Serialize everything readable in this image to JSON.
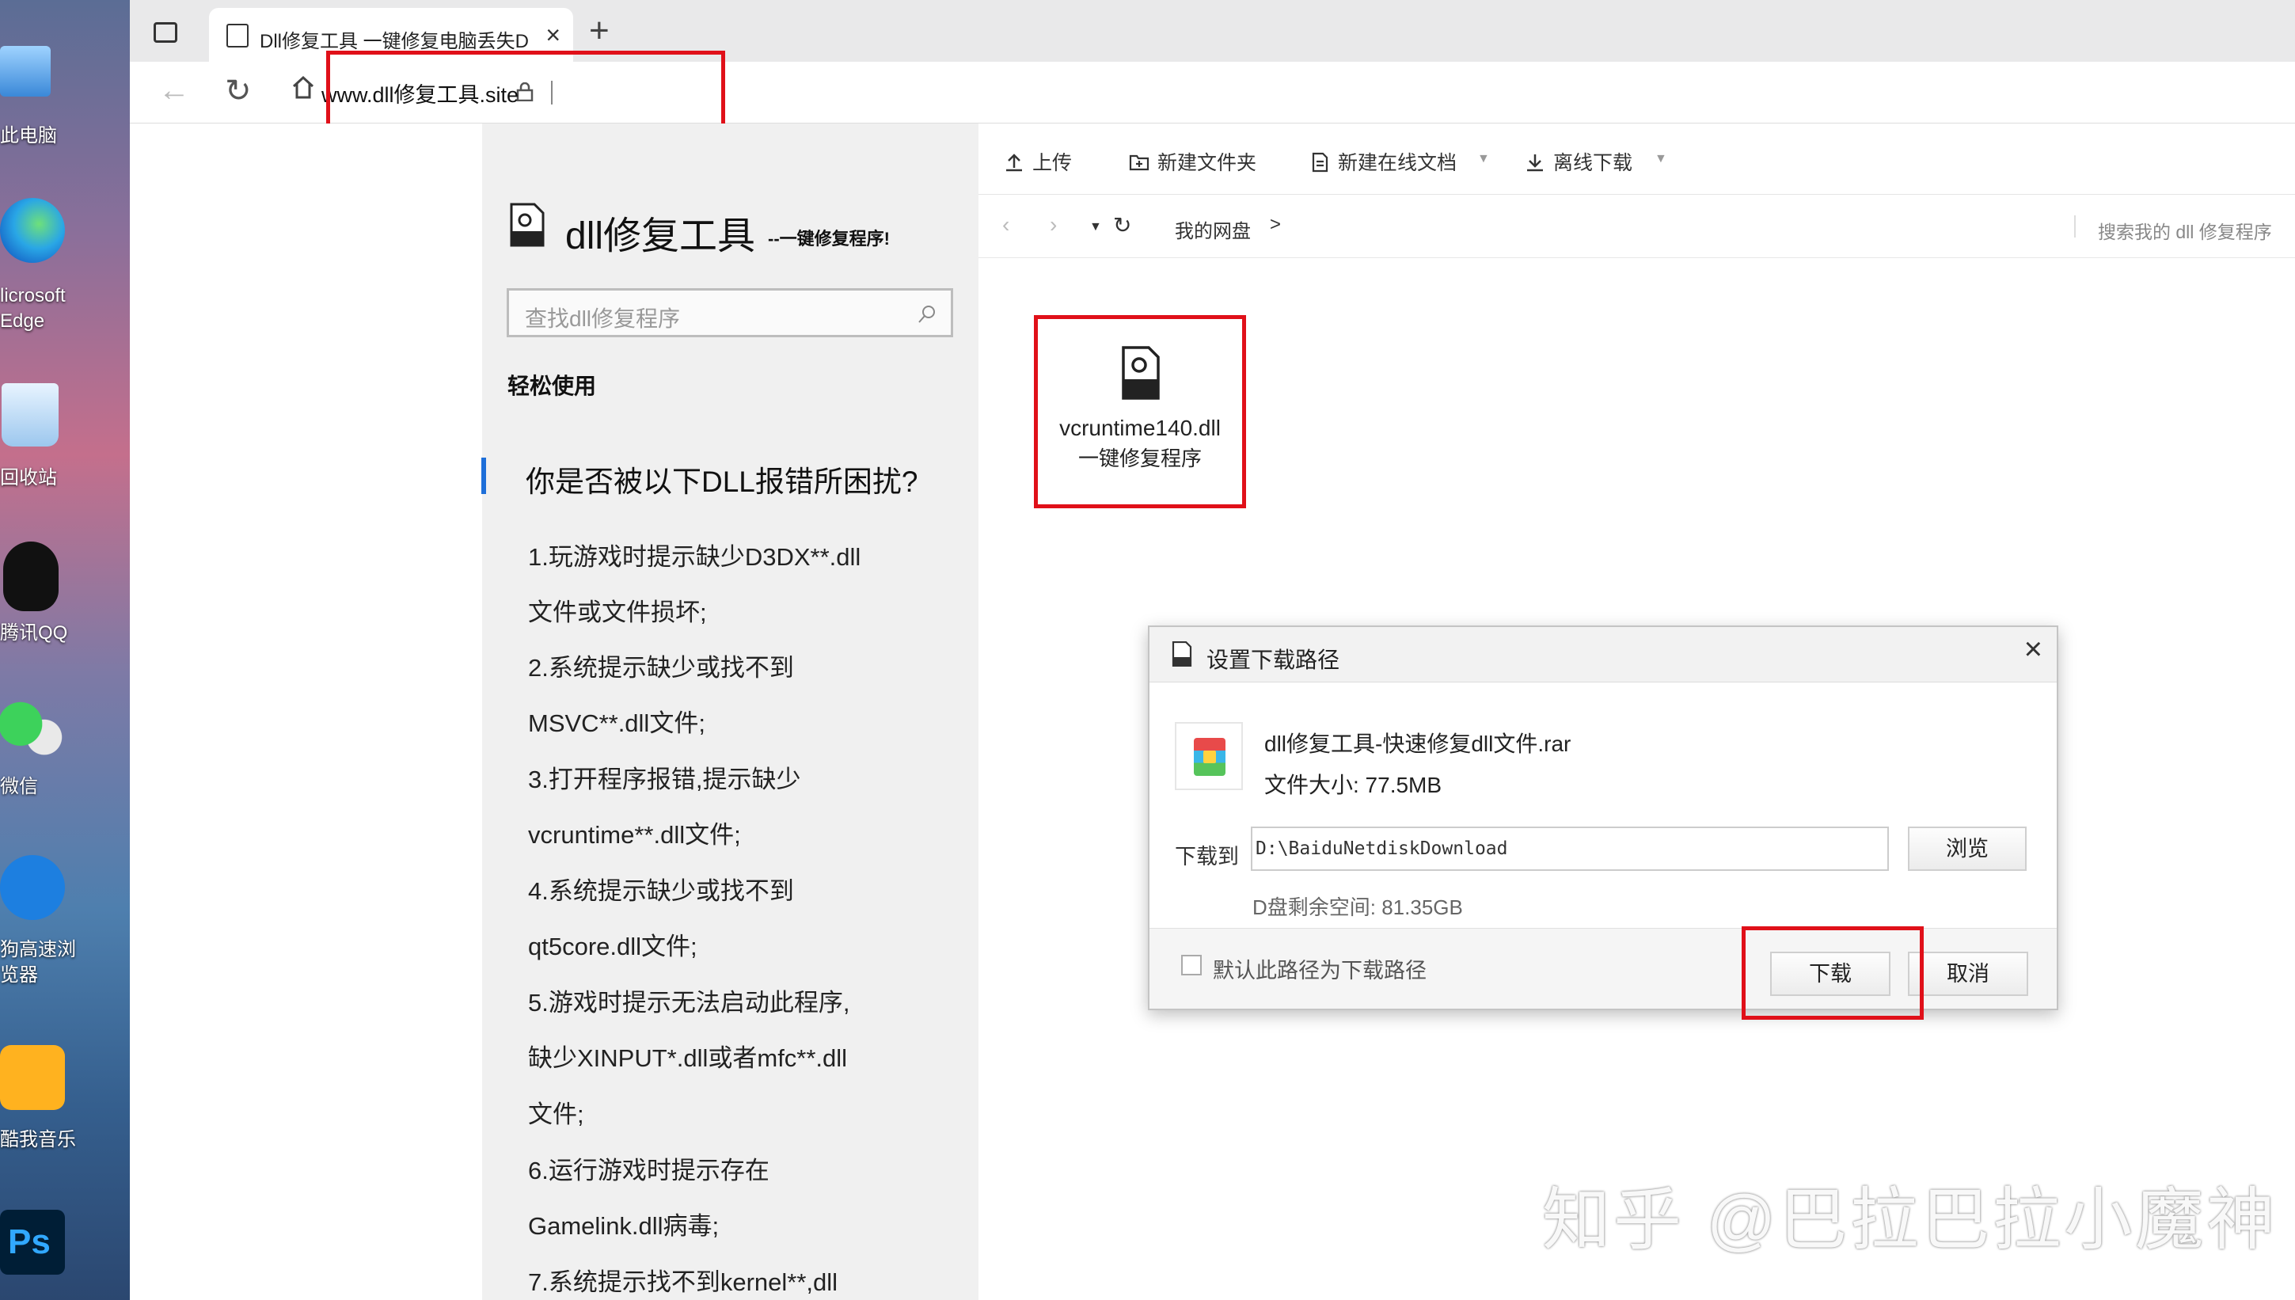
{
  "desktop": {
    "icons": [
      {
        "label": "此电脑"
      },
      {
        "label": "licrosoft\nEdge"
      },
      {
        "label": "回收站"
      },
      {
        "label": "腾讯QQ"
      },
      {
        "label": "微信"
      },
      {
        "label": "狗高速浏\n览器"
      },
      {
        "label": "酷我音乐"
      },
      {
        "label": "Ps"
      }
    ]
  },
  "browser": {
    "tab_title": "Dll修复工具 一键修复电脑丢失DLL",
    "tab_close": "×",
    "new_tab": "+",
    "url": "www.dll修复工具.site"
  },
  "sidebar": {
    "brand_name": "dll修复工具",
    "brand_sub": "--一键修复程序!",
    "search_placeholder": "查找dll修复程序",
    "section_label": "轻松使用",
    "question": "你是否被以下DLL报错所困扰?",
    "items": [
      "1.玩游戏时提示缺少D3DX**.dll",
      "文件或文件损坏;",
      "2.系统提示缺少或找不到",
      "MSVC**.dll文件;",
      "3.打开程序报错,提示缺少",
      "vcruntime**.dll文件;",
      "4.系统提示缺少或找不到",
      "qt5core.dll文件;",
      "5.游戏时提示无法启动此程序,",
      "缺少XINPUT*.dll或者mfc**.dll",
      "文件;",
      "6.运行游戏时提示存在",
      "Gamelink.dll病毒;",
      "7.系统提示找不到kernel**,dll"
    ]
  },
  "netdisk": {
    "toolbar": {
      "upload": "上传",
      "new_folder": "新建文件夹",
      "new_doc": "新建在线文档",
      "offline_download": "离线下载"
    },
    "breadcrumb": {
      "root": "我的网盘",
      "separator": ">"
    },
    "search_placeholder": "搜索我的 dll 修复程序",
    "file": {
      "name_line1": "vcruntime140.dll",
      "name_line2": "一键修复程序"
    }
  },
  "dialog": {
    "title": "设置下载路径",
    "close": "×",
    "file_name": "dll修复工具-快速修复dll文件.rar",
    "file_size": "文件大小: 77.5MB",
    "save_to_label": "下载到",
    "path_value": "D:\\BaiduNetdiskDownload",
    "browse_button": "浏览",
    "free_space": "D盘剩余空间: 81.35GB",
    "default_checkbox_label": "默认此路径为下载路径",
    "download_button": "下载",
    "cancel_button": "取消"
  },
  "watermark": "知乎 @巴拉巴拉小魔神",
  "colors": {
    "highlight": "#e01019",
    "accent_bar": "#1e6fd9"
  }
}
